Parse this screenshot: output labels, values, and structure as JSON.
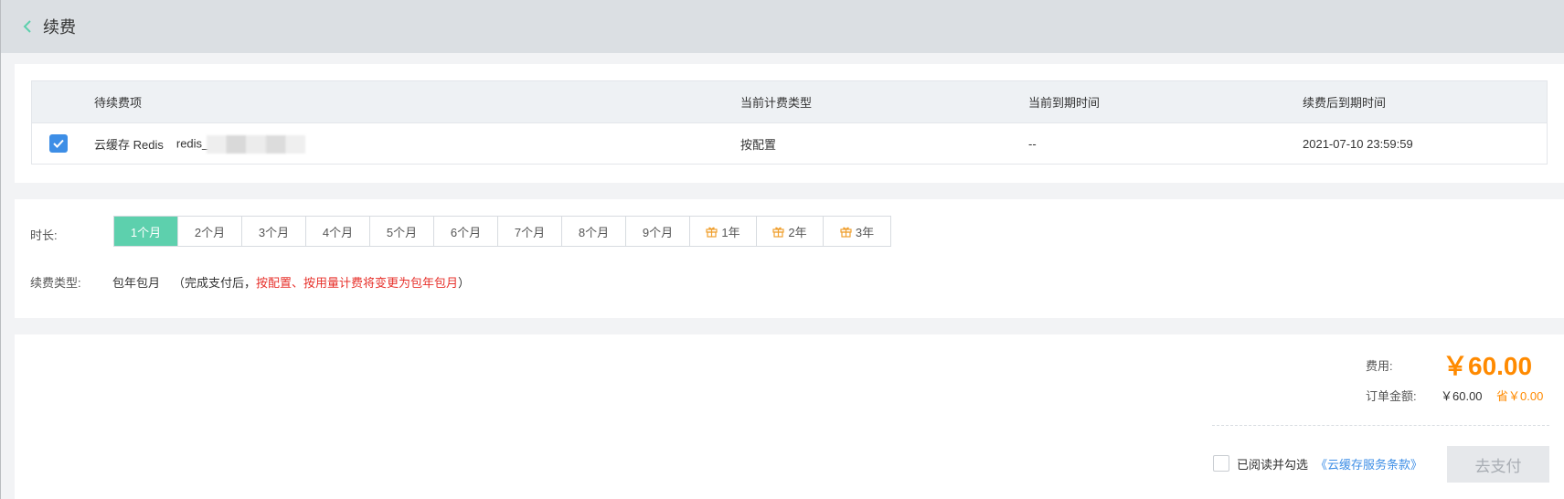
{
  "header": {
    "title": "续费"
  },
  "table": {
    "columns": [
      "待续费项",
      "当前计费类型",
      "当前到期时间",
      "续费后到期时间"
    ],
    "rows": [
      {
        "checked": true,
        "name": "云缓存 Redis",
        "id": "redis_",
        "billing_type": "按配置",
        "current_expiry": "--",
        "new_expiry": "2021-07-10 23:59:59"
      }
    ]
  },
  "duration": {
    "label": "时长:",
    "options": [
      "1个月",
      "2个月",
      "3个月",
      "4个月",
      "5个月",
      "6个月",
      "7个月",
      "8个月",
      "9个月",
      "1年",
      "2年",
      "3年"
    ],
    "selected": "1个月"
  },
  "renew": {
    "label": "续费类型:",
    "value": "包年包月",
    "note_prefix": "（完成支付后，",
    "note_red": "按配置、按用量计费将变更为包年包月",
    "note_suffix": "）"
  },
  "payment": {
    "fee_label": "费用:",
    "fee_value": "￥60.00",
    "order_label": "订单金额:",
    "order_value": "￥60.00",
    "save_value": "省￥0.00",
    "agree_text": "已阅读并勾选",
    "agree_link": "《云缓存服务条款》",
    "pay_button": "去支付"
  },
  "colors": {
    "accent": "#5dd0ad",
    "primary": "#3d8ee6",
    "price": "#ff8a00",
    "warning": "#e7312b"
  },
  "icons": {
    "back": "chevron-left-icon",
    "gift": "gift-icon",
    "check": "check-icon"
  }
}
